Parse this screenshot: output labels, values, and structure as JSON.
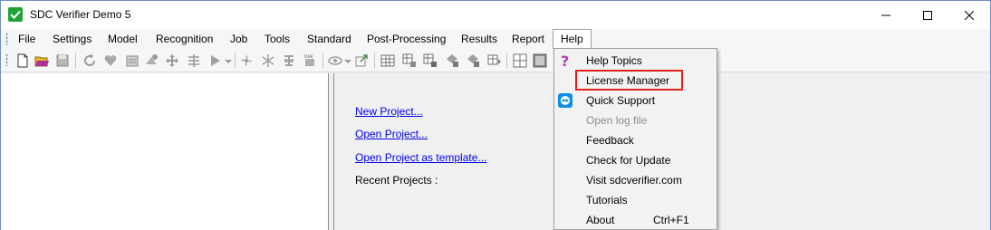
{
  "window": {
    "title": "SDC Verifier Demo 5",
    "accent_color": "#21a336"
  },
  "menubar": {
    "items": [
      {
        "label": "File"
      },
      {
        "label": "Settings"
      },
      {
        "label": "Model"
      },
      {
        "label": "Recognition"
      },
      {
        "label": "Job"
      },
      {
        "label": "Tools"
      },
      {
        "label": "Standard"
      },
      {
        "label": "Post-Processing"
      },
      {
        "label": "Results"
      },
      {
        "label": "Report"
      },
      {
        "label": "Help"
      }
    ],
    "open_menu": "Help"
  },
  "toolbar": {
    "icons": [
      "new-file-icon",
      "open-folder-icon",
      "save-icon",
      "refresh-icon",
      "heart-icon",
      "calculator-icon",
      "transform-icon",
      "move-icon",
      "align-icon",
      "play-icon",
      "fan-icon",
      "snowflake-icon",
      "tank-icon",
      "eye-icon",
      "export-icon",
      "table-icon",
      "table-chart-icon",
      "table-edit-icon",
      "shapes-icon",
      "diamond-icon",
      "grid-icon",
      "window-icon"
    ]
  },
  "start_page": {
    "links": [
      "New Project...",
      "Open Project...",
      "Open Project as template..."
    ],
    "recent_label": "Recent Projects :"
  },
  "help_menu": {
    "items": [
      {
        "label": "Help Topics",
        "icon": "question-icon",
        "enabled": true
      },
      {
        "label": "License Manager",
        "enabled": true,
        "highlighted": true
      },
      {
        "label": "Quick Support",
        "icon": "teamviewer-icon",
        "enabled": true
      },
      {
        "label": "Open log file",
        "enabled": false
      },
      {
        "label": "Feedback",
        "enabled": true
      },
      {
        "label": "Check for Update",
        "enabled": true
      },
      {
        "label": "Visit sdcverifier.com",
        "enabled": true
      },
      {
        "label": "Tutorials",
        "enabled": true
      },
      {
        "label": "About",
        "shortcut": "Ctrl+F1",
        "enabled": true
      }
    ],
    "highlight_color": "#e0201b"
  }
}
